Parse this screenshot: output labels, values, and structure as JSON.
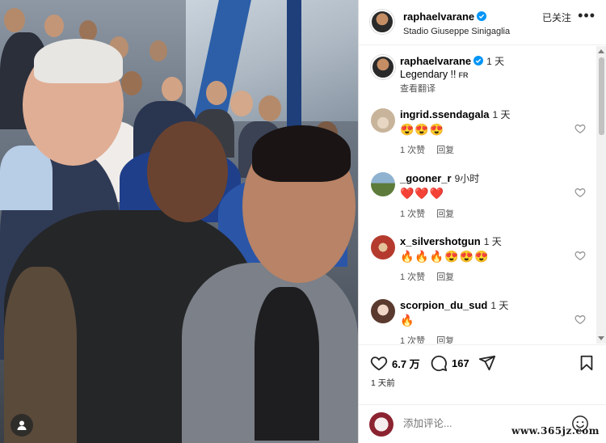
{
  "post": {
    "author": "raphaelvarane",
    "location": "Stadio Giuseppe Sinigaglia",
    "follow_status": "已关注",
    "more_icon": "more-horizontal-icon",
    "caption": "Legendary !!",
    "caption_time": "1 天",
    "caption_lang": "FR",
    "see_translation": "查看翻译"
  },
  "comments": [
    {
      "user": "ingrid.ssendagala",
      "time": "1 天",
      "emoji": "😍😍😍",
      "likes": "1 次赞",
      "reply": "回复",
      "avatar_color": "#c8b49a"
    },
    {
      "user": "_gooner_r",
      "time": "9小时",
      "emoji": "❤️❤️❤️",
      "likes": "1 次赞",
      "reply": "回复",
      "avatar_color": "#5d7b3a"
    },
    {
      "user": "x_silvershotgun",
      "time": "1 天",
      "emoji": "🔥🔥🔥😍😍😍",
      "likes": "1 次赞",
      "reply": "回复",
      "avatar_color": "#b53a2e"
    },
    {
      "user": "scorpion_du_sud",
      "time": "1 天",
      "emoji": "🔥",
      "likes": "1 次赞",
      "reply": "回复",
      "avatar_color": "#d7b9a6"
    }
  ],
  "actions": {
    "likes": "6.7 万",
    "comments": "167",
    "like_icon": "heart-icon",
    "comment_icon": "comment-icon",
    "share_icon": "send-icon",
    "save_icon": "bookmark-icon"
  },
  "posted_ago": "1 天前",
  "compose": {
    "placeholder": "添加评论...",
    "emoji_icon": "smile-icon"
  },
  "watermark": "www.365jz.com",
  "colors": {
    "verified": "#0095f6",
    "heart_red": "#ed4956",
    "stadium_blue": "#2c5fa8"
  }
}
